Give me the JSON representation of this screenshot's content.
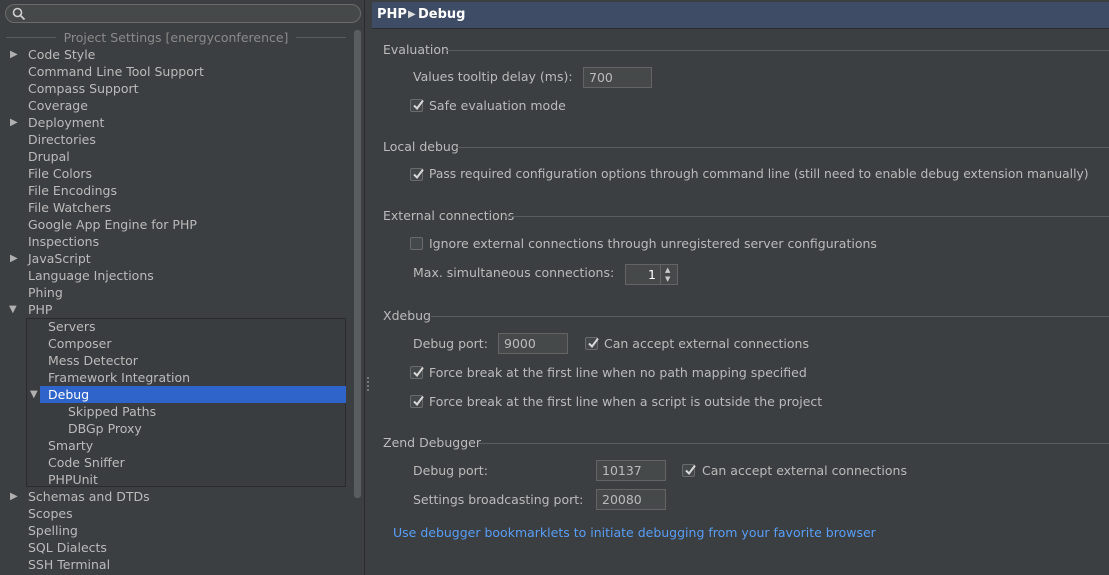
{
  "search": {
    "placeholder": ""
  },
  "sidebar": {
    "group_title": "Project Settings [energyconference]",
    "items": [
      {
        "label": "Code Style",
        "expandable": true
      },
      {
        "label": "Command Line Tool Support"
      },
      {
        "label": "Compass Support"
      },
      {
        "label": "Coverage"
      },
      {
        "label": "Deployment",
        "expandable": true
      },
      {
        "label": "Directories"
      },
      {
        "label": "Drupal"
      },
      {
        "label": "File Colors"
      },
      {
        "label": "File Encodings"
      },
      {
        "label": "File Watchers"
      },
      {
        "label": "Google App Engine for PHP"
      },
      {
        "label": "Inspections"
      },
      {
        "label": "JavaScript",
        "expandable": true
      },
      {
        "label": "Language Injections"
      },
      {
        "label": "Phing"
      },
      {
        "label": "PHP",
        "expanded": true
      },
      {
        "label": "Servers"
      },
      {
        "label": "Composer"
      },
      {
        "label": "Mess Detector"
      },
      {
        "label": "Framework Integration"
      },
      {
        "label": "Debug",
        "expanded": true,
        "selected": true
      },
      {
        "label": "Skipped Paths"
      },
      {
        "label": "DBGp Proxy"
      },
      {
        "label": "Smarty"
      },
      {
        "label": "Code Sniffer"
      },
      {
        "label": "PHPUnit"
      },
      {
        "label": "Schemas and DTDs",
        "expandable": true
      },
      {
        "label": "Scopes"
      },
      {
        "label": "Spelling"
      },
      {
        "label": "SQL Dialects"
      },
      {
        "label": "SSH Terminal"
      }
    ]
  },
  "header": {
    "crumb1": "PHP",
    "crumb2": "Debug"
  },
  "evaluation": {
    "title": "Evaluation",
    "tooltip_delay_label": "Values tooltip delay (ms):",
    "tooltip_delay_value": "700",
    "safe_mode_label": "Safe evaluation mode",
    "safe_mode_checked": true
  },
  "local_debug": {
    "title": "Local debug",
    "pass_options_label": "Pass required configuration options through command line (still need to enable debug extension manually)",
    "pass_options_checked": true
  },
  "external": {
    "title": "External connections",
    "ignore_label": "Ignore external connections through unregistered server configurations",
    "ignore_checked": false,
    "max_conn_label": "Max. simultaneous connections:",
    "max_conn_value": "1"
  },
  "xdebug": {
    "title": "Xdebug",
    "port_label": "Debug port:",
    "port_value": "9000",
    "accept_label": "Can accept external connections",
    "accept_checked": true,
    "force_no_mapping_label": "Force break at the first line when no path mapping specified",
    "force_no_mapping_checked": true,
    "force_outside_label": "Force break at the first line when a script is outside the project",
    "force_outside_checked": true
  },
  "zend": {
    "title": "Zend Debugger",
    "port_label": "Debug port:",
    "port_value": "10137",
    "accept_label": "Can accept external connections",
    "accept_checked": true,
    "broadcast_label": "Settings broadcasting port:",
    "broadcast_value": "20080"
  },
  "bookmarklets_link": "Use debugger bookmarklets to initiate debugging from your favorite browser"
}
